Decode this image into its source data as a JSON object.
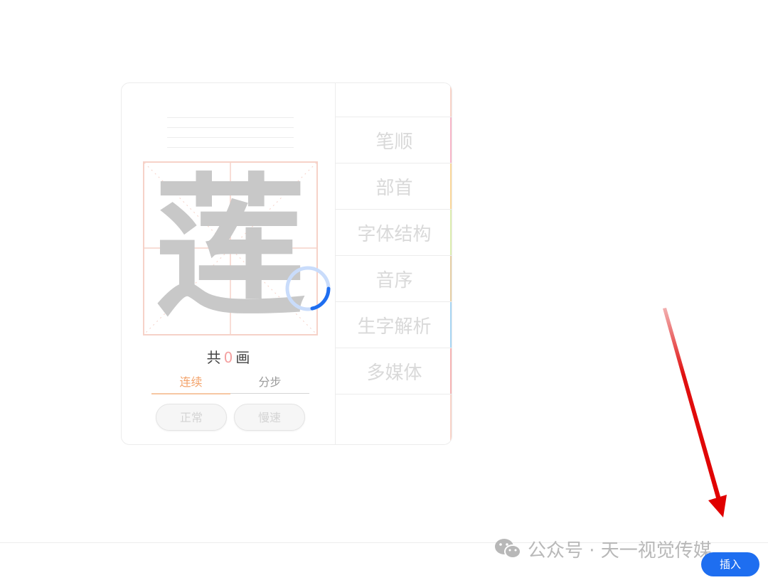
{
  "character": "莲",
  "stroke_count": {
    "prefix": "共",
    "value": "0",
    "suffix": "画"
  },
  "mode_tabs": [
    {
      "label": "连续",
      "active": true
    },
    {
      "label": "分步",
      "active": false
    }
  ],
  "speed_buttons": [
    {
      "label": "正常"
    },
    {
      "label": "慢速"
    }
  ],
  "menu": [
    {
      "label": "笔顺",
      "color": "#f7b6c8"
    },
    {
      "label": "部首",
      "color": "#fad79a"
    },
    {
      "label": "字体结构",
      "color": "#dcecb0"
    },
    {
      "label": "音序",
      "color": "#e6cfa6"
    },
    {
      "label": "生字解析",
      "color": "#a9d6f3"
    },
    {
      "label": "多媒体",
      "color": "#f6b4b4"
    }
  ],
  "watermark": "公众号 · 天一视觉传媒",
  "insert_button": "插入",
  "colors": {
    "accent": "#1e6ef0",
    "tab_active": "#f3a36b",
    "grid_border": "#f6d2c8",
    "stroke_number": "#f4a0a0"
  }
}
